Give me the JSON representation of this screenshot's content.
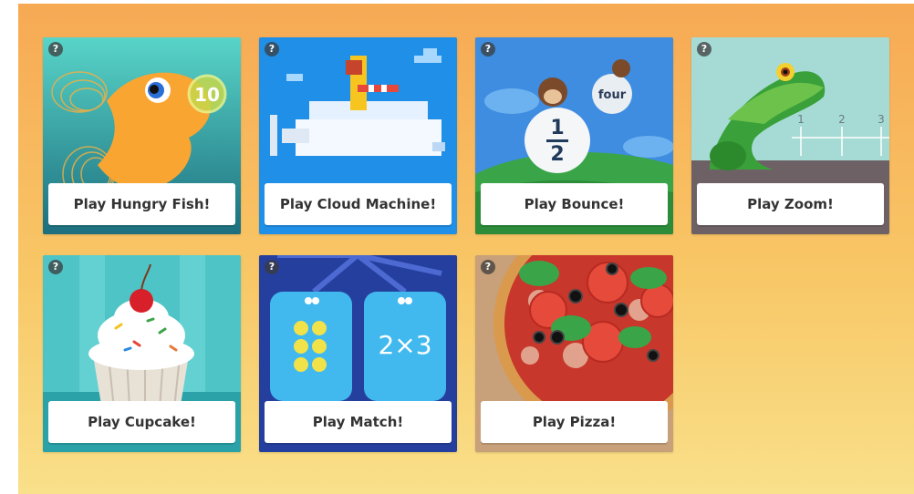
{
  "games": [
    {
      "id": "hungry-fish",
      "label": "Play Hungry Fish!",
      "help": "?",
      "bubble_number": "10"
    },
    {
      "id": "cloud-machine",
      "label": "Play Cloud Machine!",
      "help": "?"
    },
    {
      "id": "bounce",
      "label": "Play Bounce!",
      "help": "?",
      "ball_word": "four",
      "fraction_num": "1",
      "fraction_den": "2"
    },
    {
      "id": "zoom",
      "label": "Play Zoom!",
      "help": "?",
      "axis_ticks": [
        "1",
        "2",
        "3"
      ]
    },
    {
      "id": "cupcake",
      "label": "Play Cupcake!",
      "help": "?"
    },
    {
      "id": "match",
      "label": "Play Match!",
      "help": "?",
      "expression": "2×3"
    },
    {
      "id": "pizza",
      "label": "Play Pizza!",
      "help": "?"
    }
  ],
  "colors": {
    "background_top": "#f7a954",
    "background_bottom": "#f9e08a",
    "button_bg": "#ffffff",
    "button_text": "#333333"
  }
}
